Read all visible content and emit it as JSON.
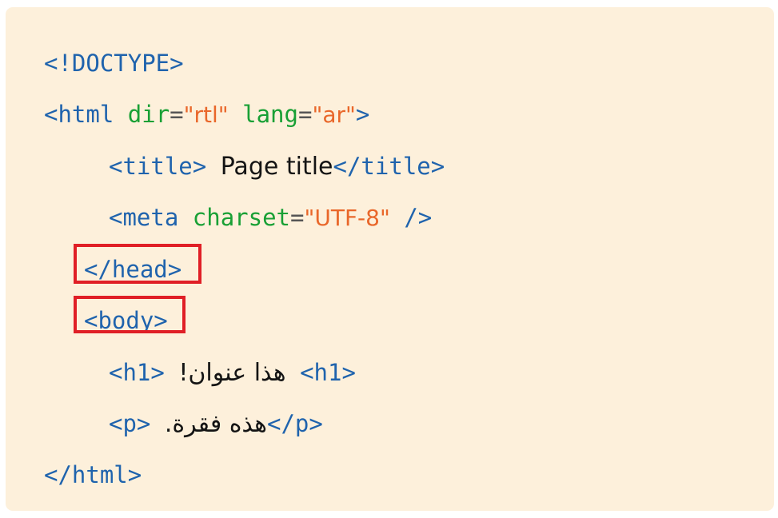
{
  "code": {
    "doctype": "<!DOCTYPE>",
    "html_open": {
      "tag_start": "<html",
      "attr1_name": "dir",
      "attr1_eq": "=",
      "attr1_value": "\"rtl\"",
      "attr2_name": "lang",
      "attr2_eq": "=",
      "attr2_value": "\"ar\"",
      "tag_end": ">"
    },
    "title_line": {
      "open": "<title>",
      "text": "Page title",
      "close": "</title>"
    },
    "meta_line": {
      "tag_start": "<meta",
      "attr_name": "charset",
      "attr_eq": "=",
      "attr_value": "\"UTF-8\"",
      "tag_end": "/>"
    },
    "head_close": "</head>",
    "body_open": "<body>",
    "h1_line": {
      "open": "<h1>",
      "text": "هذا عنوان!",
      "close": "<h1>"
    },
    "p_line": {
      "open": "<p>",
      "text": "هذه فقرة.",
      "close": "</p>"
    },
    "html_close": "</html>"
  },
  "highlight_color": "#e01f26",
  "colors": {
    "tag": "#1f63ad",
    "attribute": "#19a035",
    "value": "#e9672a",
    "text": "#141414",
    "background": "#fdf0db"
  }
}
